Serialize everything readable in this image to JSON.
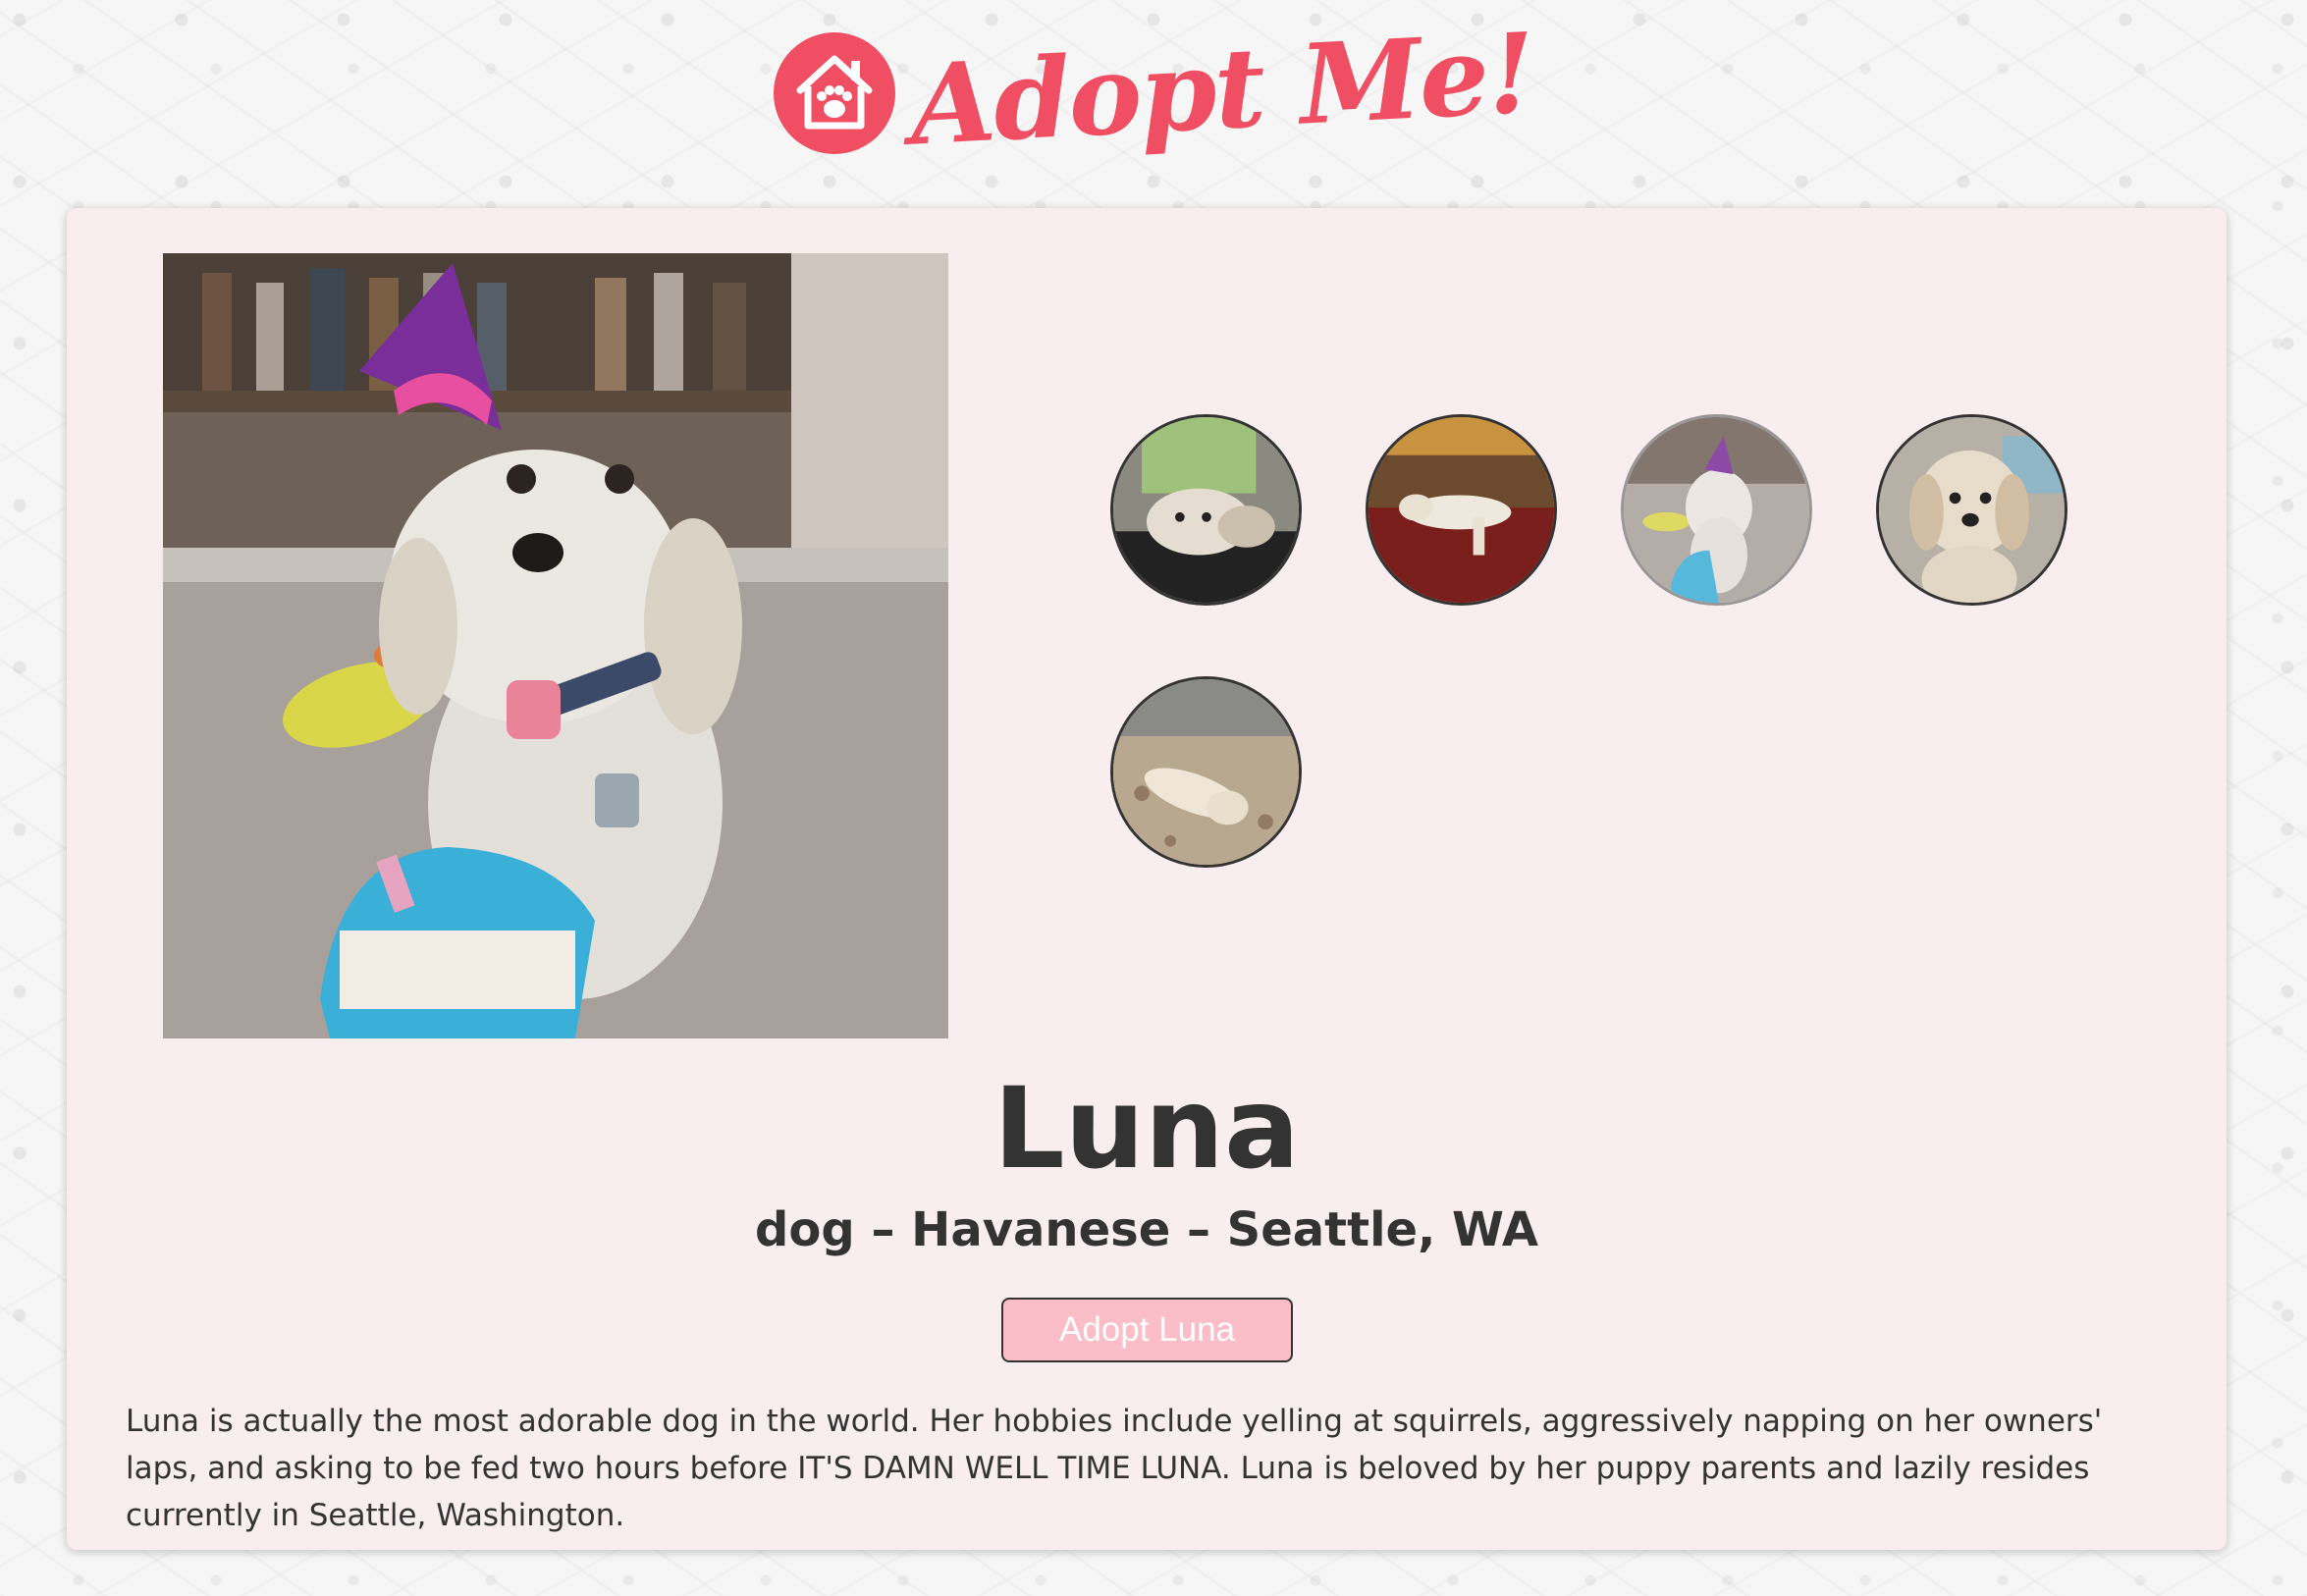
{
  "header": {
    "logo_text": "Adopt Me!",
    "logo_icon": "paw-house-icon",
    "brand_color": "#f04e63"
  },
  "pet": {
    "name": "Luna",
    "info": "dog – Havanese – Seattle, WA",
    "adopt_label": "Adopt Luna",
    "description": "Luna is actually the most adorable dog in the world. Her hobbies include yelling at squirrels, aggressively napping on her owners' laps, and asking to be fed two hours before IT'S DAMN WELL TIME LUNA. Luna is beloved by her puppy parents and lazily resides currently in Seattle, Washington."
  },
  "carousel": {
    "active_index": 2,
    "thumbnails": [
      {
        "alt": "dog-resting-head-photo"
      },
      {
        "alt": "dog-on-couch-photo"
      },
      {
        "alt": "dog-party-hat-photo"
      },
      {
        "alt": "dog-portrait-photo"
      },
      {
        "alt": "dog-lying-on-rug-photo"
      }
    ]
  },
  "colors": {
    "card_bg": "#f8edef",
    "button_bg": "#fbbdc8",
    "text": "#333333"
  }
}
